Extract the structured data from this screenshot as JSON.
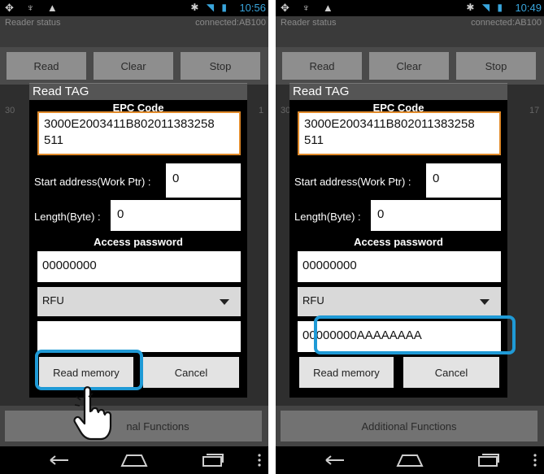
{
  "colors": {
    "highlight": "#1f9ad6",
    "focus_border": "#e08a2a",
    "status_accent": "#39a5dc"
  },
  "left": {
    "status_time": "10:56",
    "reader_status_label": "Reader status",
    "reader_status_value": "connected:AB100",
    "toolbar": {
      "read": "Read",
      "clear": "Clear",
      "stop": "Stop"
    },
    "side_left": "30",
    "side_right": "1",
    "dialog": {
      "title": "Read TAG",
      "epc_label": "EPC Code",
      "epc_value_line1": "3000E2003411B802011383258",
      "epc_value_line2": "511",
      "start_label": "Start address(Work Ptr) :",
      "start_value": "0",
      "length_label": "Length(Byte) :",
      "length_value": "0",
      "password_label": "Access password",
      "password_value": "00000000",
      "bank_value": "RFU",
      "data_value": "",
      "read_memory": "Read memory",
      "cancel": "Cancel"
    },
    "additional_functions": "nal Functions"
  },
  "right": {
    "status_time": "10:49",
    "reader_status_label": "Reader status",
    "reader_status_value": "connected:AB100",
    "toolbar": {
      "read": "Read",
      "clear": "Clear",
      "stop": "Stop"
    },
    "side_left": "30",
    "side_right": "17",
    "dialog": {
      "title": "Read TAG",
      "epc_label": "EPC Code",
      "epc_value_line1": "3000E2003411B802011383258",
      "epc_value_line2": "511",
      "start_label": "Start address(Work Ptr) :",
      "start_value": "0",
      "length_label": "Length(Byte) :",
      "length_value": "0",
      "password_label": "Access password",
      "password_value": "00000000",
      "bank_value": "RFU",
      "data_value": "00000000AAAAAAAA",
      "read_memory": "Read memory",
      "cancel": "Cancel"
    },
    "additional_functions": "Additional Functions"
  }
}
